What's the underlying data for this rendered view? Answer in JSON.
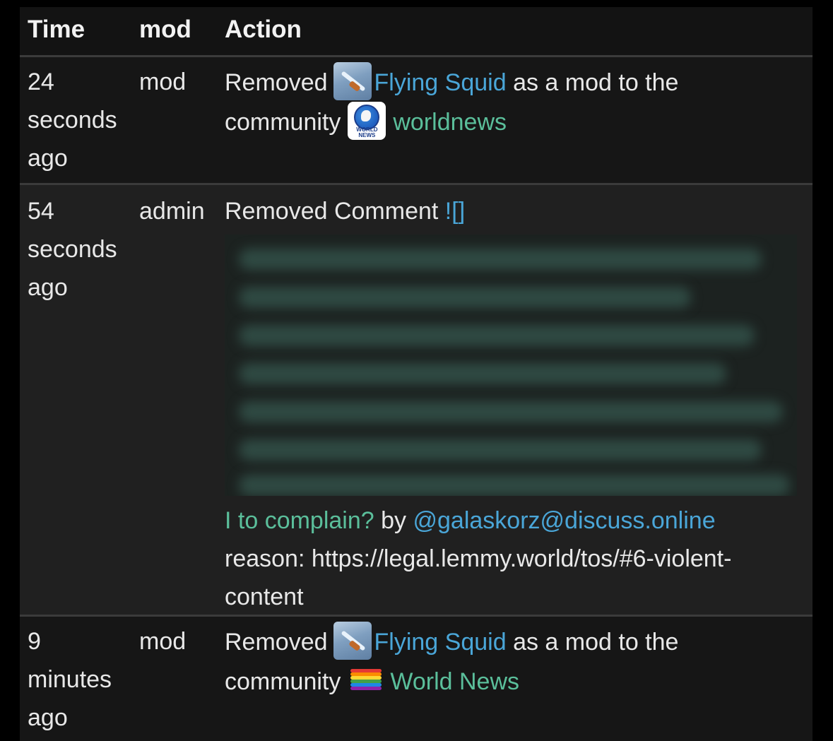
{
  "table": {
    "headers": {
      "time": "Time",
      "mod": "mod",
      "action": "Action"
    },
    "rows": [
      {
        "time": [
          "24",
          "seconds",
          "ago"
        ],
        "mod": "mod",
        "action": {
          "verb": "Removed",
          "user": "Flying Squid",
          "middle": "as a mod to the",
          "community_word": "community",
          "community": "worldnews",
          "community_icon_text": "WORLD NEWS"
        }
      },
      {
        "time": [
          "54",
          "seconds",
          "ago"
        ],
        "mod": "admin",
        "action": {
          "verb": "Removed Comment",
          "link": "![]",
          "comment_tail": "I to complain?",
          "by": "by",
          "author": "@galaskorz@discuss.online",
          "reason": "reason: https://legal.lemmy.world/tos/#6-violent-",
          "reason_tail": "content"
        }
      },
      {
        "time": [
          "9",
          "minutes",
          "ago"
        ],
        "mod": "mod",
        "action": {
          "verb": "Removed",
          "user": "Flying Squid",
          "middle": "as a mod to the",
          "community_word": "community",
          "community": "World News"
        }
      }
    ]
  },
  "colors": {
    "link_blue": "#4aa6d8",
    "link_green": "#5bbf9b",
    "background": "#1a1a1a"
  },
  "icons": {
    "user_avatar": "flying-squid-avatar-icon",
    "community_avatar_1": "worldnews-globe-icon",
    "community_avatar_2": "rainbow-world-news-icon"
  }
}
